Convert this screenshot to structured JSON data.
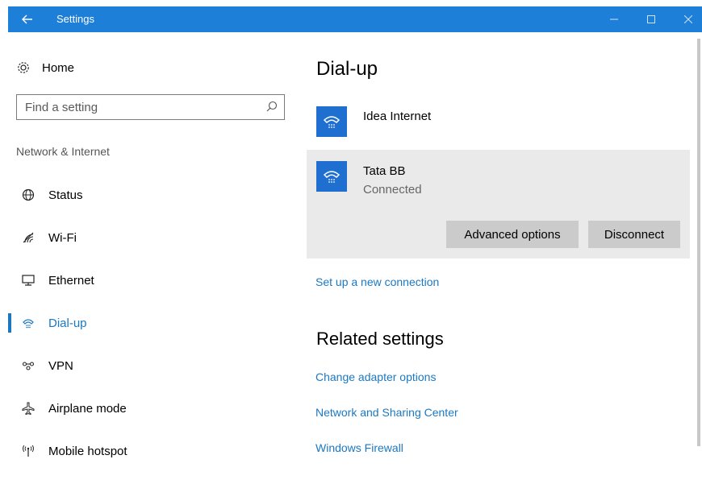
{
  "window": {
    "title": "Settings"
  },
  "sidebar": {
    "home_label": "Home",
    "search_placeholder": "Find a setting",
    "section_label": "Network & Internet",
    "items": [
      {
        "label": "Status",
        "icon": "globe-icon"
      },
      {
        "label": "Wi-Fi",
        "icon": "wifi-icon"
      },
      {
        "label": "Ethernet",
        "icon": "ethernet-icon"
      },
      {
        "label": "Dial-up",
        "icon": "dialup-icon",
        "active": true
      },
      {
        "label": "VPN",
        "icon": "vpn-icon"
      },
      {
        "label": "Airplane mode",
        "icon": "airplane-icon"
      },
      {
        "label": "Mobile hotspot",
        "icon": "hotspot-icon"
      }
    ]
  },
  "main": {
    "title": "Dial-up",
    "connections": [
      {
        "name": "Idea Internet",
        "status": ""
      },
      {
        "name": "Tata BB",
        "status": "Connected",
        "selected": true
      }
    ],
    "buttons": {
      "advanced": "Advanced options",
      "disconnect": "Disconnect"
    },
    "setup_link": "Set up a new connection",
    "related_title": "Related settings",
    "related_links": [
      "Change adapter options",
      "Network and Sharing Center",
      "Windows Firewall"
    ]
  },
  "colors": {
    "titlebar": "#1e7fd8",
    "accent": "#1a78c2",
    "tile": "#1e6fd0",
    "panel": "#eaeaea",
    "button": "#cbcbcb"
  }
}
